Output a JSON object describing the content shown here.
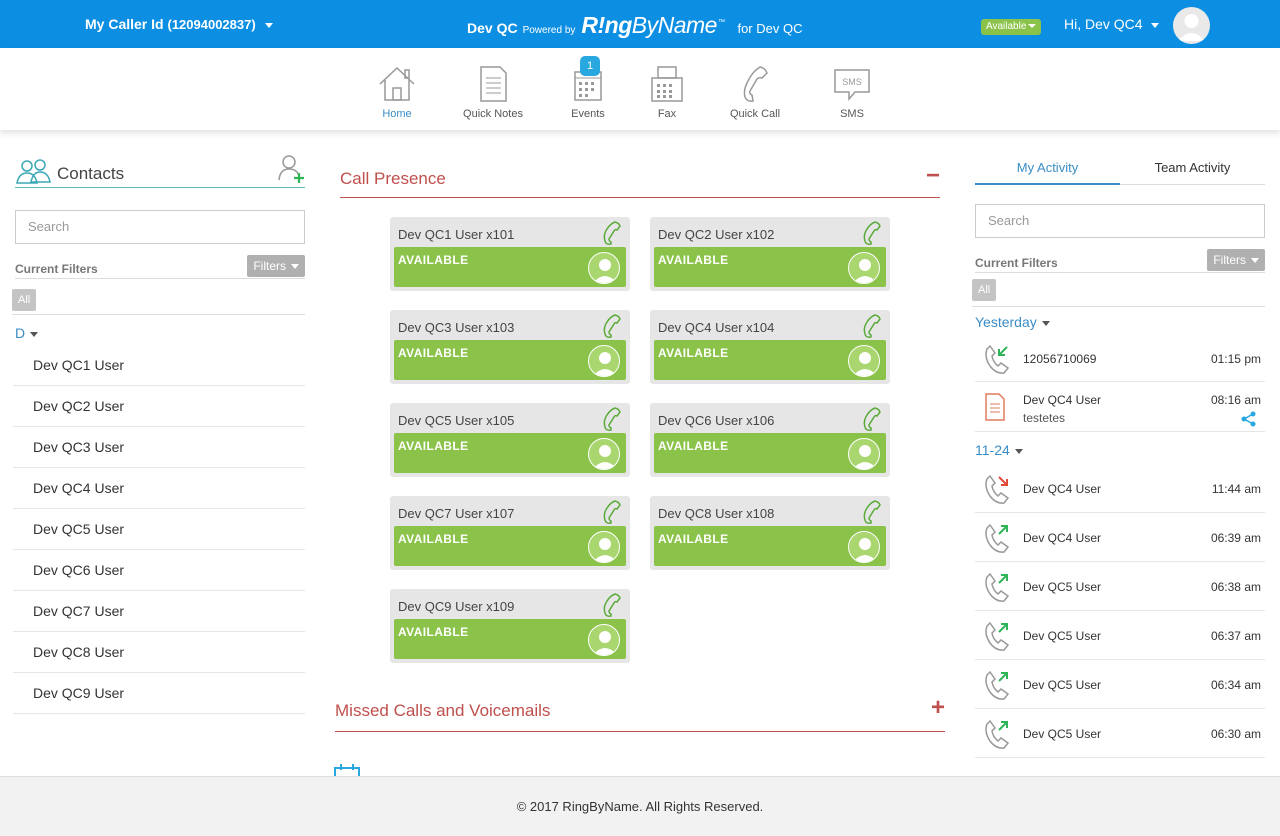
{
  "header": {
    "caller_label": "My Caller Id",
    "caller_number": "(12094002837)",
    "org": "Dev QC",
    "powered_by": "Powered by",
    "logo_bold": "R!ng",
    "logo_rest": "ByName",
    "for_org": "for Dev QC",
    "status": "Available",
    "greeting": "Hi, Dev QC4"
  },
  "nav": {
    "items": [
      {
        "label": "Home",
        "icon": "home-icon",
        "active": true
      },
      {
        "label": "Quick Notes",
        "icon": "notes-icon"
      },
      {
        "label": "Events",
        "icon": "calendar-icon",
        "badge": "1"
      },
      {
        "label": "Fax",
        "icon": "fax-icon"
      },
      {
        "label": "Quick Call",
        "icon": "phone-icon"
      },
      {
        "label": "SMS",
        "icon": "sms-icon"
      }
    ]
  },
  "contacts": {
    "title": "Contacts",
    "search_placeholder": "Search",
    "current_filters": "Current Filters",
    "filters_button": "Filters",
    "all_chip": "All",
    "group_letter": "D",
    "items": [
      "Dev QC1 User",
      "Dev QC2 User",
      "Dev QC3 User",
      "Dev QC4 User",
      "Dev QC5 User",
      "Dev QC6 User",
      "Dev QC7 User",
      "Dev QC8 User",
      "Dev QC9 User"
    ]
  },
  "presence": {
    "title": "Call Presence",
    "collapse_symbol": "−",
    "cards": [
      {
        "name": "Dev QC1 User x101",
        "status": "AVAILABLE"
      },
      {
        "name": "Dev QC2 User x102",
        "status": "AVAILABLE"
      },
      {
        "name": "Dev QC3 User x103",
        "status": "AVAILABLE"
      },
      {
        "name": "Dev QC4 User x104",
        "status": "AVAILABLE"
      },
      {
        "name": "Dev QC5 User x105",
        "status": "AVAILABLE"
      },
      {
        "name": "Dev QC6 User x106",
        "status": "AVAILABLE"
      },
      {
        "name": "Dev QC7 User x107",
        "status": "AVAILABLE"
      },
      {
        "name": "Dev QC8 User x108",
        "status": "AVAILABLE"
      },
      {
        "name": "Dev QC9 User x109",
        "status": "AVAILABLE"
      }
    ]
  },
  "missed": {
    "title": "Missed Calls and Voicemails",
    "expand_symbol": "+"
  },
  "activity": {
    "tab_my": "My Activity",
    "tab_team": "Team Activity",
    "search_placeholder": "Search",
    "current_filters": "Current Filters",
    "filters_button": "Filters",
    "all_chip": "All",
    "group_yesterday": "Yesterday",
    "group_date": "11-24",
    "yesterday": [
      {
        "who": "12056710069",
        "time": "01:15 pm",
        "icon": "incoming-call-icon"
      },
      {
        "who": "Dev QC4 User",
        "sub": "testetes",
        "time": "08:16 am",
        "icon": "note-icon"
      }
    ],
    "dated": [
      {
        "who": "Dev QC4 User",
        "time": "11:44 am",
        "icon": "missed-call-icon"
      },
      {
        "who": "Dev QC4 User",
        "time": "06:39 am",
        "icon": "outgoing-call-icon"
      },
      {
        "who": "Dev QC5 User",
        "time": "06:38 am",
        "icon": "outgoing-call-icon"
      },
      {
        "who": "Dev QC5 User",
        "time": "06:37 am",
        "icon": "outgoing-call-icon"
      },
      {
        "who": "Dev QC5 User",
        "time": "06:34 am",
        "icon": "outgoing-call-icon"
      },
      {
        "who": "Dev QC5 User",
        "time": "06:30 am",
        "icon": "outgoing-call-icon"
      }
    ]
  },
  "footer": {
    "text": "© 2017 RingByName. All Rights Reserved."
  },
  "colors": {
    "topbar": "#0c8fe3",
    "available": "#8bc34a",
    "section_red": "#c0504d",
    "accent_blue": "#3a8dc7"
  }
}
